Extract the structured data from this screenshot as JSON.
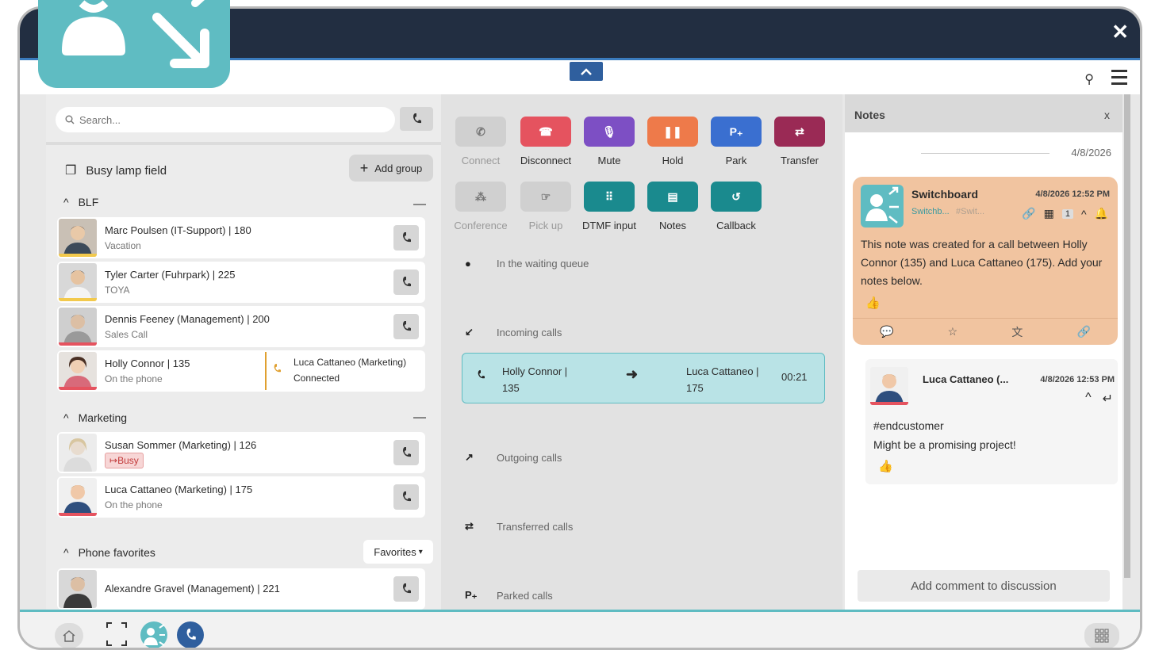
{
  "search": {
    "placeholder": "Search..."
  },
  "blf": {
    "title": "Busy lamp field",
    "add_group": "Add group",
    "groups": [
      {
        "name": "BLF"
      },
      {
        "name": "Marketing"
      },
      {
        "name": "Phone favorites",
        "dropdown": "Favorites"
      }
    ],
    "contacts": [
      {
        "name": "Marc Poulsen (IT-Support) | 180",
        "status": "Vacation"
      },
      {
        "name": "Tyler Carter (Fuhrpark) | 225",
        "status": "TOYA"
      },
      {
        "name": "Dennis Feeney (Management) | 200",
        "status": "Sales Call"
      },
      {
        "name": "Holly Connor | 135",
        "status": "On the phone",
        "connected_to": "Luca Cattaneo (Marketing)",
        "connected_status": "Connected"
      },
      {
        "name": "Susan Sommer (Marketing) | 126",
        "badge": "Busy"
      },
      {
        "name": "Luca Cattaneo (Marketing) | 175",
        "status": "On the phone"
      },
      {
        "name": "Alexandre Gravel (Management) | 221"
      }
    ]
  },
  "actions": [
    {
      "label": "Connect",
      "color": "#d0d0d0"
    },
    {
      "label": "Disconnect",
      "color": "#e5535f"
    },
    {
      "label": "Mute",
      "color": "#7d4fc4"
    },
    {
      "label": "Hold",
      "color": "#ee7a4a"
    },
    {
      "label": "Park",
      "color": "#3a6fd0",
      "glyph": "P₊"
    },
    {
      "label": "Transfer",
      "color": "#9a2a55"
    },
    {
      "label": "Conference",
      "color": "#d0d0d0"
    },
    {
      "label": "Pick up",
      "color": "#d0d0d0"
    },
    {
      "label": "DTMF input",
      "color": "#1a8a8e"
    },
    {
      "label": "Notes",
      "color": "#1a8a8e"
    },
    {
      "label": "Callback",
      "color": "#1a8a8e"
    }
  ],
  "queues": {
    "waiting": "In the waiting queue",
    "incoming": "Incoming calls",
    "outgoing": "Outgoing calls",
    "transferred": "Transferred calls",
    "parked": "Parked calls",
    "parked_glyph": "P₊"
  },
  "active_call": {
    "from_line1": "Holly Connor |",
    "from_line2": "135",
    "to_line1": "Luca Cattaneo |",
    "to_line2": "175",
    "duration": "00:21"
  },
  "notes": {
    "title": "Notes",
    "date": "4/8/2026",
    "card": {
      "title": "Switchboard",
      "time": "4/8/2026 12:52 PM",
      "sub": "Switchb...",
      "sub2": "#Swit...",
      "count": "1",
      "body": "This note was created for a call between Holly Connor (135) and Luca Cattaneo (175). Add your notes below."
    },
    "reply": {
      "name": "Luca Cattaneo (...",
      "time": "4/8/2026 12:53 PM",
      "tag": "#endcustomer",
      "text": "Might be a promising project!"
    },
    "add_comment": "Add comment to discussion"
  },
  "colors": {
    "accent": "#5fbcc2",
    "topbar": "#222e41",
    "call_highlight": "#b9e3e6",
    "note_card": "#f1c4a0"
  }
}
